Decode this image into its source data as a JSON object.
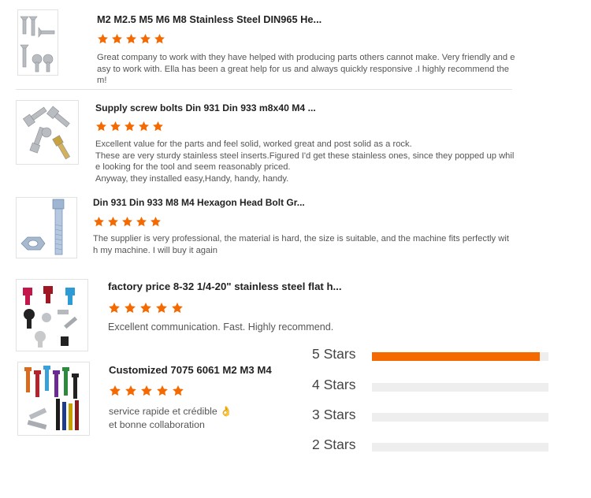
{
  "colors": {
    "accent": "#f56a00",
    "track": "#eeeeee"
  },
  "reviews": [
    {
      "title": "M2 M2.5 M5 M6 M8 Stainless Steel DIN965 He...",
      "rating": 5,
      "thumb_icon": "countersunk-screws-thumbnail",
      "body": [
        "Great company to work with they have helped with producing parts others cannot make. Very friendly and e",
        "asy to work with. Ella has been a great help for us and always quickly responsive .I highly recommend the",
        "m!"
      ]
    },
    {
      "title": "Supply screw bolts Din 931 Din 933 m8x40 M4 ...",
      "rating": 5,
      "thumb_icon": "assorted-bolts-thumbnail",
      "body": [
        "Excellent value for the parts and feel solid, worked great and post solid as a rock.",
        "These are very sturdy stainless steel inserts.Figured I'd get these stainless ones, since they popped up whil",
        "e looking for the tool and seem reasonably priced.",
        "Anyway, they installed easy,Handy, handy, handy."
      ]
    },
    {
      "title": "Din 931 Din 933 M8 M4 Hexagon Head Bolt Gr...",
      "rating": 5,
      "thumb_icon": "hex-bolt-nut-thumbnail",
      "body": [
        "The supplier is very professional, the material is hard, the size is suitable, and the machine fits perfectly wit",
        "h my machine. I will buy it again"
      ]
    },
    {
      "title": "factory price 8-32 1/4-20\" stainless steel flat h...",
      "rating": 5,
      "thumb_icon": "colored-screws-thumbnail",
      "body": [
        "Excellent communication. Fast. Highly recommend."
      ]
    },
    {
      "title": "Customized 7075 6061 M2 M3 M4",
      "rating": 5,
      "thumb_icon": "anodized-bolts-thumbnail",
      "body": [
        "service rapide et crédible",
        "et bonne collaboration"
      ],
      "emoji": "👌"
    }
  ],
  "rating_summary": [
    {
      "label": "5 Stars",
      "fraction": 0.95
    },
    {
      "label": "4 Stars",
      "fraction": 0
    },
    {
      "label": "3 Stars",
      "fraction": 0
    },
    {
      "label": "2 Stars",
      "fraction": 0
    }
  ]
}
